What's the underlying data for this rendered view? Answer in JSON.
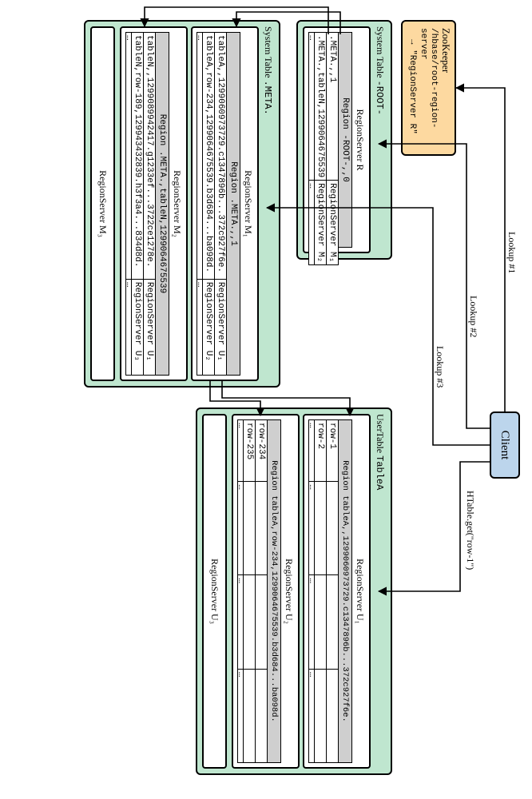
{
  "zookeeper": {
    "title": "ZooKeeper",
    "path": "/hbase/root-region-server",
    "resolves": "→ \"RegionServer R\""
  },
  "client": {
    "label": "Client"
  },
  "labels": {
    "lookup1": "Lookup #1",
    "lookup2": "Lookup #2",
    "lookup3": "Lookup #3",
    "get": "HTable.get(\"row-1\")"
  },
  "root": {
    "title": "System Table -ROOT-",
    "rs": "RegionServer R",
    "region": "Region -ROOT-,,0",
    "rows": [
      {
        "k": ".META.,,1",
        "v": "RegionServer M₁"
      },
      {
        "k": ".META.,tableN,1299064675539",
        "v": "RegionServer M₂"
      }
    ]
  },
  "meta": {
    "title": "System Table .META.",
    "servers": [
      {
        "rs": "RegionServer M₁",
        "region": "Region .META.,,1",
        "rows": [
          {
            "k": "tableA,,1299060973729.c1347896b...372c927f6e.",
            "v": "RegionServer U₁"
          },
          {
            "k": "tableA,row-234,1299064675539.b3d684...ba098d.",
            "v": "RegionServer U₂"
          }
        ]
      },
      {
        "rs": "RegionServer M₂",
        "region": "Region .META.,tableN,1299064675539",
        "rows": [
          {
            "k": "tableN,,1299089942417.g1233ef...3722ce1278e.",
            "v": "RegionServer U₁"
          },
          {
            "k": "tableN,row-189,129943432839.h3f3a4...834d8d.",
            "v": "RegionServer U₃"
          }
        ]
      }
    ],
    "empty": "RegionServer M₃"
  },
  "user": {
    "title": "UserTable TableA",
    "servers": [
      {
        "rs": "RegionServer U₁",
        "region": "Region tableA,,1299060973729.c1347896b...372c927f6e.",
        "rows": [
          {
            "k": "row-1"
          },
          {
            "k": "row-2"
          }
        ]
      },
      {
        "rs": "RegionServer U₂",
        "region": "Region tableA,row-234,1299064675539.b3d684...ba098d.",
        "rows": [
          {
            "k": "row-234"
          },
          {
            "k": "row-235"
          }
        ]
      }
    ],
    "empty": "RegionServer U₃"
  }
}
